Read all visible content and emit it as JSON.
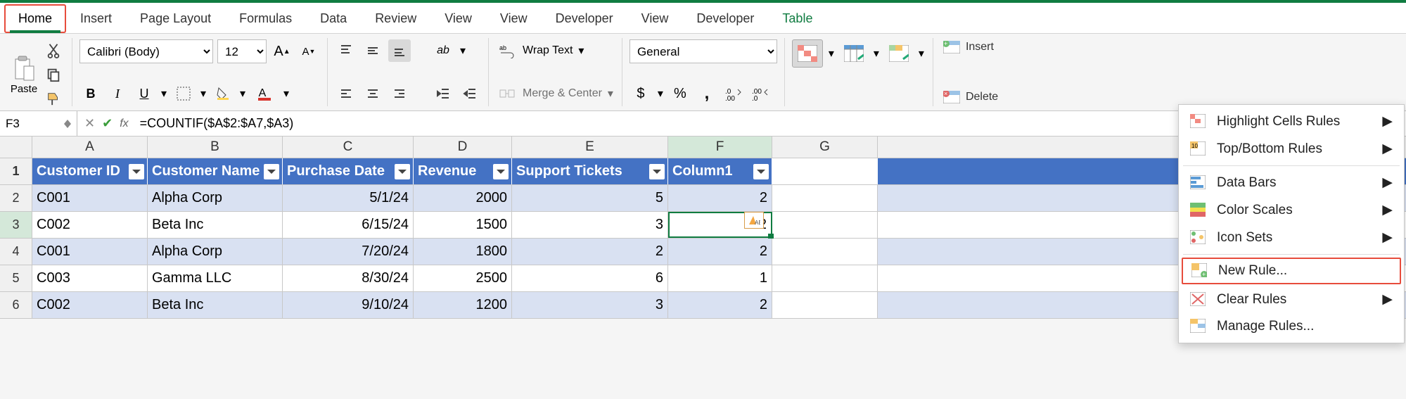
{
  "tabs": [
    "Home",
    "Insert",
    "Page Layout",
    "Formulas",
    "Data",
    "Review",
    "View",
    "View",
    "Developer",
    "View",
    "Developer",
    "Table"
  ],
  "active_tab": "Home",
  "clipboard": {
    "paste_label": "Paste"
  },
  "font": {
    "name": "Calibri (Body)",
    "size": "12"
  },
  "alignment": {
    "wraptext": "Wrap Text",
    "merge": "Merge & Center"
  },
  "number_format": "General",
  "cells_group": {
    "insert": "Insert",
    "delete": "Delete"
  },
  "name_box": "F3",
  "formula": "=COUNTIF($A$2:$A7,$A3)",
  "columns": [
    "A",
    "B",
    "C",
    "D",
    "E",
    "F",
    "G"
  ],
  "table": {
    "headers": [
      "Customer ID",
      "Customer Name",
      "Purchase Date",
      "Revenue",
      "Support Tickets",
      "Column1"
    ],
    "rows": [
      {
        "n": "2",
        "cells": [
          "C001",
          "Alpha Corp",
          "5/1/24",
          "2000",
          "5",
          "2"
        ],
        "band": "odd"
      },
      {
        "n": "3",
        "cells": [
          "C002",
          "Beta Inc",
          "6/15/24",
          "1500",
          "3",
          "2"
        ],
        "band": "even",
        "selected": true
      },
      {
        "n": "4",
        "cells": [
          "C001",
          "Alpha Corp",
          "7/20/24",
          "1800",
          "2",
          "2"
        ],
        "band": "odd"
      },
      {
        "n": "5",
        "cells": [
          "C003",
          "Gamma LLC",
          "8/30/24",
          "2500",
          "6",
          "1"
        ],
        "band": "even"
      },
      {
        "n": "6",
        "cells": [
          "C002",
          "Beta Inc",
          "9/10/24",
          "1200",
          "3",
          "2"
        ],
        "band": "odd"
      }
    ]
  },
  "cf_menu": {
    "items": [
      {
        "label": "Highlight Cells Rules",
        "sub": true,
        "icon": "highlight"
      },
      {
        "label": "Top/Bottom Rules",
        "sub": true,
        "icon": "topbottom"
      },
      {
        "sep": true
      },
      {
        "label": "Data Bars",
        "sub": true,
        "icon": "databars"
      },
      {
        "label": "Color Scales",
        "sub": true,
        "icon": "colorscales"
      },
      {
        "label": "Icon Sets",
        "sub": true,
        "icon": "iconsets"
      },
      {
        "sep": true
      },
      {
        "label": "New Rule...",
        "sub": false,
        "boxed": true,
        "icon": "newrule"
      },
      {
        "label": "Clear Rules",
        "sub": true,
        "icon": "clearrules"
      },
      {
        "label": "Manage Rules...",
        "sub": false,
        "icon": "managerules"
      }
    ]
  }
}
